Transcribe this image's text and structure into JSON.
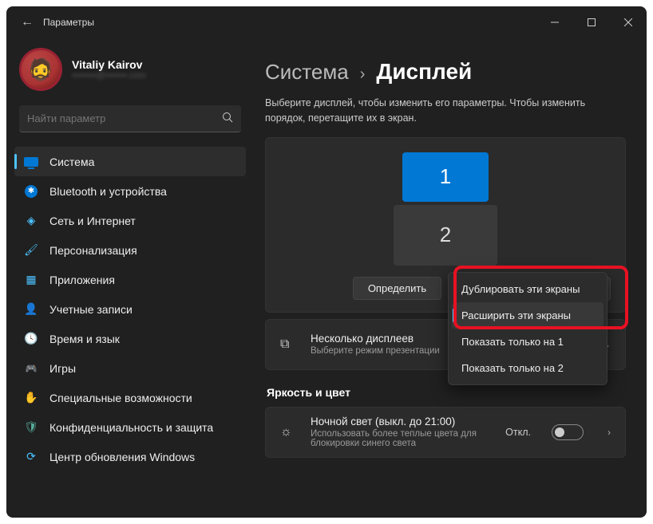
{
  "window": {
    "title": "Параметры"
  },
  "profile": {
    "name": "Vitaliy Kairov",
    "email": "••••••••@•••••••.com"
  },
  "search": {
    "placeholder": "Найти параметр"
  },
  "nav": [
    {
      "key": "system",
      "label": "Система",
      "selected": true
    },
    {
      "key": "bluetooth",
      "label": "Bluetooth и устройства"
    },
    {
      "key": "network",
      "label": "Сеть и Интернет"
    },
    {
      "key": "personalization",
      "label": "Персонализация"
    },
    {
      "key": "apps",
      "label": "Приложения"
    },
    {
      "key": "accounts",
      "label": "Учетные записи"
    },
    {
      "key": "time",
      "label": "Время и язык"
    },
    {
      "key": "gaming",
      "label": "Игры"
    },
    {
      "key": "accessibility",
      "label": "Специальные возможности"
    },
    {
      "key": "privacy",
      "label": "Конфиденциальность и защита"
    },
    {
      "key": "update",
      "label": "Центр обновления Windows"
    }
  ],
  "breadcrumb": {
    "parent": "Система",
    "sep": "›",
    "current": "Дисплей"
  },
  "display_panel": {
    "help": "Выберите дисплей, чтобы изменить его параметры. Чтобы изменить порядок, перетащите их в экран.",
    "display1": "1",
    "display2": "2",
    "identify": "Определить",
    "mode_selected": "Расширить эти экраны"
  },
  "mode_menu": {
    "items": [
      {
        "label": "Дублировать эти экраны",
        "selected": false
      },
      {
        "label": "Расширить эти экраны",
        "selected": true
      },
      {
        "label": "Показать только на 1",
        "selected": false
      },
      {
        "label": "Показать только на 2",
        "selected": false
      }
    ]
  },
  "multi_display": {
    "title": "Несколько дисплеев",
    "sub": "Выберите режим презентации"
  },
  "brightness_section": {
    "heading": "Яркость и цвет"
  },
  "night_light": {
    "title": "Ночной свет (выкл. до 21:00)",
    "sub": "Использовать более теплые цвета для блокировки синего света",
    "state": "Откл."
  }
}
